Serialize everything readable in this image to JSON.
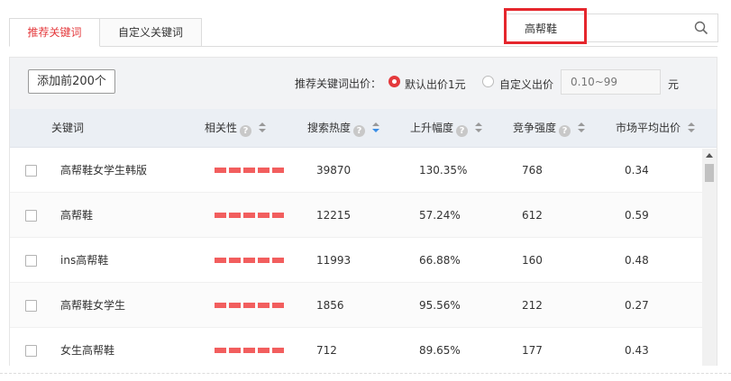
{
  "tabs": [
    {
      "label": "推荐关键词",
      "active": true
    },
    {
      "label": "自定义关键词",
      "active": false
    }
  ],
  "search": {
    "value": "高帮鞋",
    "highlight_color": "#e5262d"
  },
  "toolbar": {
    "add_button_label": "添加前200个",
    "bid_label": "推荐关键词出价：",
    "option_default": "默认出价1元",
    "option_custom": "自定义出价",
    "bid_placeholder": "0.10~99",
    "unit": "元"
  },
  "table": {
    "headers": {
      "keyword": "关键词",
      "relevance": "相关性",
      "search_heat": "搜索热度",
      "rise": "上升幅度",
      "competition": "竞争强度",
      "avg_bid": "市场平均出价"
    },
    "rows": [
      {
        "keyword": "高帮鞋女学生韩版",
        "relevance_level": 5,
        "search_heat": "39870",
        "rise": "130.35%",
        "competition": "768",
        "avg_bid": "0.34"
      },
      {
        "keyword": "高帮鞋",
        "relevance_level": 5,
        "search_heat": "12215",
        "rise": "57.24%",
        "competition": "612",
        "avg_bid": "0.59"
      },
      {
        "keyword": "ins高帮鞋",
        "relevance_level": 5,
        "search_heat": "11993",
        "rise": "66.88%",
        "competition": "160",
        "avg_bid": "0.48"
      },
      {
        "keyword": "高帮鞋女学生",
        "relevance_level": 5,
        "search_heat": "1856",
        "rise": "95.56%",
        "competition": "212",
        "avg_bid": "0.27"
      },
      {
        "keyword": "女生高帮鞋",
        "relevance_level": 5,
        "search_heat": "712",
        "rise": "89.65%",
        "competition": "177",
        "avg_bid": "0.43"
      }
    ]
  },
  "colors": {
    "accent": "#e4393c",
    "relevance_bar": "#f25e5e"
  },
  "icons": {
    "search": "search-icon",
    "help": "question-circle-icon",
    "sort": "sort-icon"
  }
}
